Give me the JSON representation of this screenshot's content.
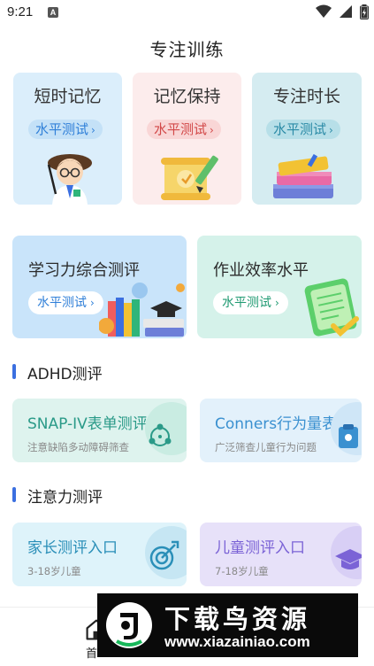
{
  "status_bar": {
    "time": "9:21",
    "notification_letter": "A"
  },
  "header": {
    "title": "专注训练"
  },
  "top_cards": [
    {
      "title": "短时记忆",
      "pill": "水平测试",
      "pill_color": "#2f7fd8",
      "pill_bg": "#c4e1f7",
      "illustration": "teacher-illustration"
    },
    {
      "title": "记忆保持",
      "pill": "水平测试",
      "pill_color": "#d24848",
      "pill_bg": "#f9d6d6",
      "illustration": "scroll-pencil-illustration"
    },
    {
      "title": "专注时长",
      "pill": "水平测试",
      "pill_color": "#2a8aa6",
      "pill_bg": "#b7dfe8",
      "illustration": "books-illustration"
    }
  ],
  "wide_cards": [
    {
      "title": "学习力综合测评",
      "pill": "水平测试",
      "pill_color": "#2f7fd8",
      "illustration": "books-grad-cap-illustration"
    },
    {
      "title": "作业效率水平",
      "pill": "水平测试",
      "pill_color": "#1f9a72",
      "illustration": "notebook-check-illustration"
    }
  ],
  "sections": [
    {
      "title": "ADHD测评",
      "cards": [
        {
          "title": "SNAP-IV表单测评",
          "subtitle": "注意缺陷多动障碍筛查",
          "title_color": "#2a9a88",
          "icon": "network-icon"
        },
        {
          "title": "Conners行为量表",
          "subtitle": "广泛筛查儿童行为问题",
          "title_color": "#3a90d0",
          "icon": "clipboard-icon"
        }
      ]
    },
    {
      "title": "注意力测评",
      "cards": [
        {
          "title": "家长测评入口",
          "subtitle": "3-18岁儿童",
          "title_color": "#2a8fb8",
          "icon": "target-icon"
        },
        {
          "title": "儿童测评入口",
          "subtitle": "7-18岁儿童",
          "title_color": "#7b63d6",
          "icon": "grad-cap-icon"
        }
      ]
    }
  ],
  "tab_bar": {
    "home_label": "首"
  },
  "watermark": {
    "text": "下载鸟资源",
    "url": "www.xiazainiao.com"
  }
}
